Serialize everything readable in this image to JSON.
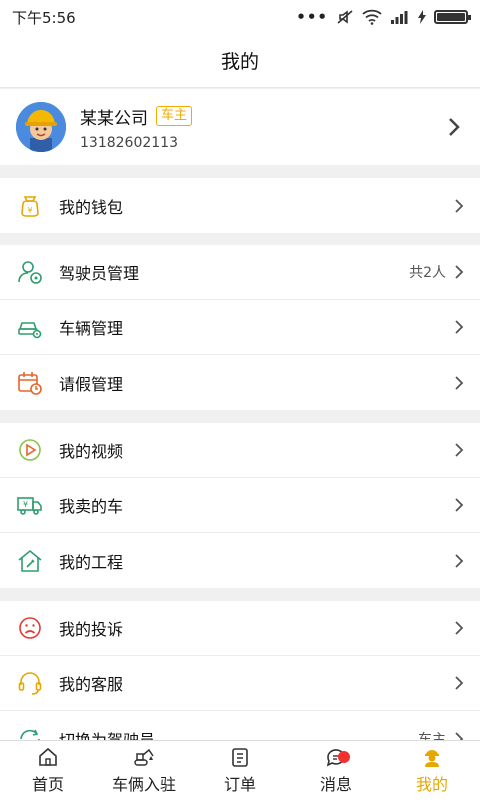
{
  "status": {
    "time": "下午5:56"
  },
  "title": "我的",
  "profile": {
    "name": "某某公司",
    "role_badge": "车主",
    "phone": "13182602113"
  },
  "groups": [
    [
      {
        "icon": "wallet-icon",
        "label": "我的钱包",
        "extra": ""
      }
    ],
    [
      {
        "icon": "driver-icon",
        "label": "驾驶员管理",
        "extra": "共2人"
      },
      {
        "icon": "vehicle-icon",
        "label": "车辆管理",
        "extra": ""
      },
      {
        "icon": "calendar-icon",
        "label": "请假管理",
        "extra": ""
      }
    ],
    [
      {
        "icon": "video-icon",
        "label": "我的视频",
        "extra": ""
      },
      {
        "icon": "truck-sale-icon",
        "label": "我卖的车",
        "extra": ""
      },
      {
        "icon": "project-icon",
        "label": "我的工程",
        "extra": ""
      }
    ],
    [
      {
        "icon": "complaint-icon",
        "label": "我的投诉",
        "extra": ""
      },
      {
        "icon": "headset-icon",
        "label": "我的客服",
        "extra": ""
      },
      {
        "icon": "switch-icon",
        "label": "切换为驾驶员",
        "extra": "车主"
      }
    ]
  ],
  "tabs": [
    {
      "label": "首页",
      "icon": "home-icon"
    },
    {
      "label": "车俩入驻",
      "icon": "excavator-icon"
    },
    {
      "label": "订单",
      "icon": "order-icon"
    },
    {
      "label": "消息",
      "icon": "message-icon"
    },
    {
      "label": "我的",
      "icon": "person-icon"
    }
  ],
  "colors": {
    "accent": "#e6a800",
    "badge": "#f2a900",
    "notify": "#f23030",
    "divider_bg": "#f0f0f0"
  }
}
